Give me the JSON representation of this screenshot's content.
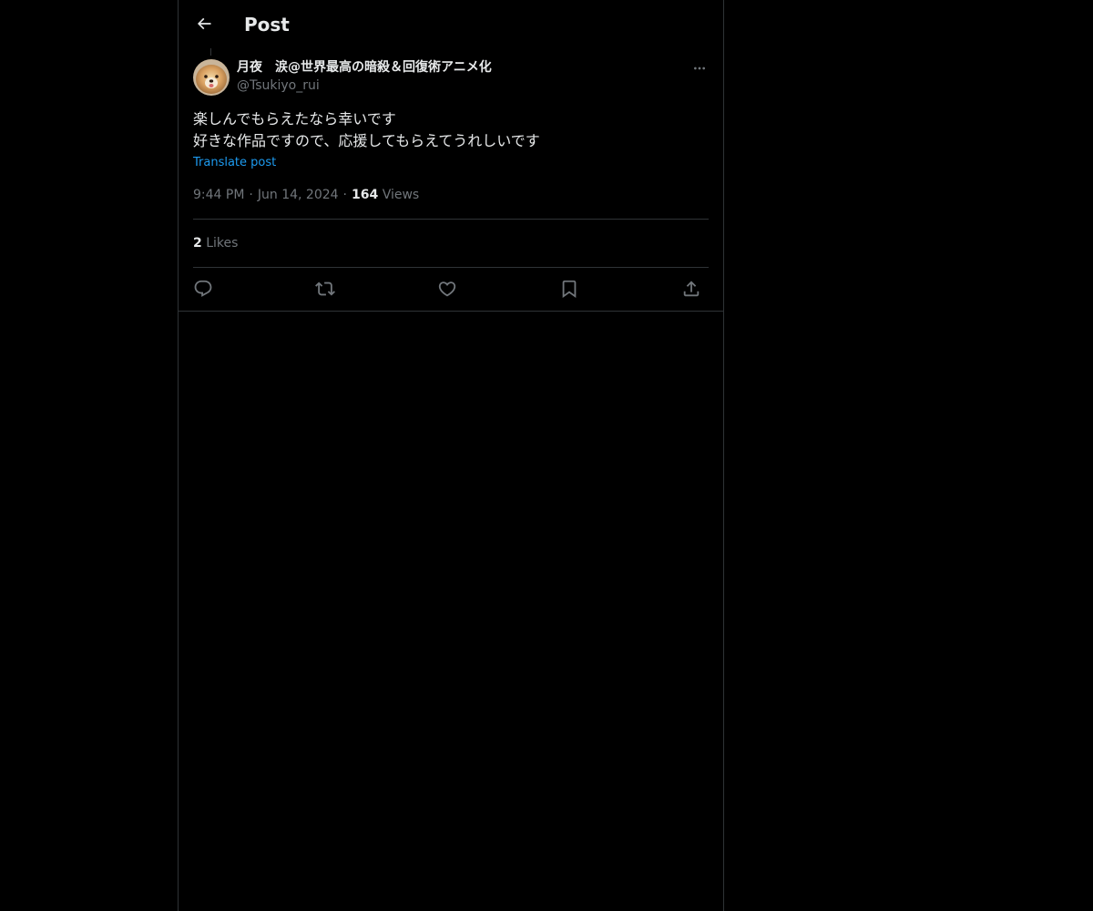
{
  "header": {
    "title": "Post",
    "back_icon": "arrow-left-icon"
  },
  "post": {
    "author": {
      "display_name": "月夜　涙@世界最高の暗殺＆回復術アニメ化",
      "handle": "@Tsukiyo_rui",
      "avatar": "avatar-image"
    },
    "text_lines": [
      "楽しんでもらえたなら幸いです",
      "好きな作品ですので、応援してもらえてうれしいです"
    ],
    "translate_label": "Translate post",
    "time": "9:44 PM",
    "separator": "·",
    "date": "Jun 14, 2024",
    "views_count": "164",
    "views_label": "Views",
    "likes_count": "2",
    "likes_label": "Likes"
  },
  "actions": [
    "reply-icon",
    "repost-icon",
    "like-icon",
    "bookmark-icon",
    "share-icon"
  ],
  "colors": {
    "background": "#000000",
    "text": "#e7e9ea",
    "muted": "#71767b",
    "accent": "#1d9bf0",
    "border": "#2f3336"
  }
}
